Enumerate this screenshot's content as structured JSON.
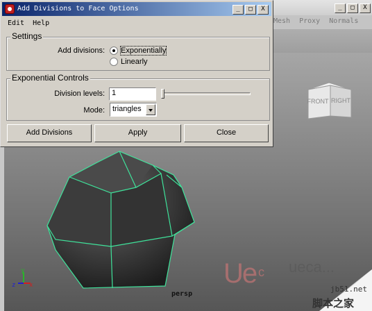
{
  "dialog": {
    "title": "Add Divisions to Face Options",
    "menu": [
      "Edit",
      "Help"
    ],
    "settings": {
      "label": "Settings",
      "add_divisions_label": "Add divisions:",
      "options": [
        "Exponentially",
        "Linearly"
      ],
      "selected": "Exponentially"
    },
    "exp_controls": {
      "label": "Exponential Controls",
      "division_levels_label": "Division levels:",
      "division_levels_value": "1",
      "mode_label": "Mode:",
      "mode_value": "triangles"
    },
    "buttons": {
      "add": "Add Divisions",
      "apply": "Apply",
      "close": "Close"
    },
    "window_controls": {
      "minimize": "_",
      "maximize": "□",
      "close": "X"
    }
  },
  "background_window": {
    "menu": [
      "Mesh",
      "Proxy",
      "Normals"
    ],
    "window_controls": {
      "minimize": "_",
      "maximize": "□",
      "close": "X"
    }
  },
  "viewport": {
    "camera_label": "persp",
    "viewcube": {
      "front": "FRONT",
      "right": "RIGHT"
    },
    "axis": {
      "x": "x",
      "y": "y",
      "z": "z"
    },
    "wireframe_color": "#3fe39b"
  },
  "watermark": {
    "logo": "Ue",
    "logo_suffix": "c",
    "text": "ueca...",
    "site": "jb51.net",
    "chinese": "脚本之家"
  },
  "colors": {
    "title_dark": "#0a246a",
    "title_light": "#a6caf0",
    "dialog_bg": "#d4d0c8"
  }
}
